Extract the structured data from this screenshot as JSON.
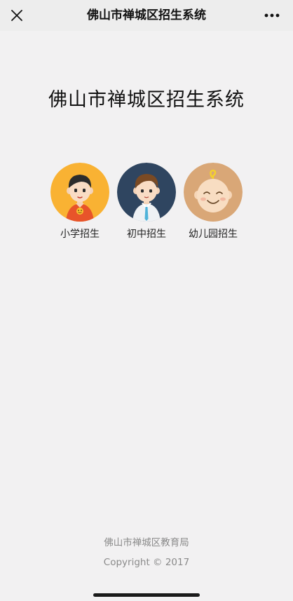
{
  "nav": {
    "title": "佛山市禅城区招生系统",
    "close_icon": "close-icon",
    "more_icon": "more-icon"
  },
  "main": {
    "title": "佛山市禅城区招生系统",
    "options": [
      {
        "label": "小学招生",
        "icon": "boy-avatar-icon",
        "color": "#f9b233"
      },
      {
        "label": "初中招生",
        "icon": "student-avatar-icon",
        "color": "#2f4560"
      },
      {
        "label": "幼儿园招生",
        "icon": "baby-avatar-icon",
        "color": "#d9a777"
      }
    ]
  },
  "footer": {
    "org": "佛山市禅城区教育局",
    "copyright": "Copyright © 2017"
  }
}
